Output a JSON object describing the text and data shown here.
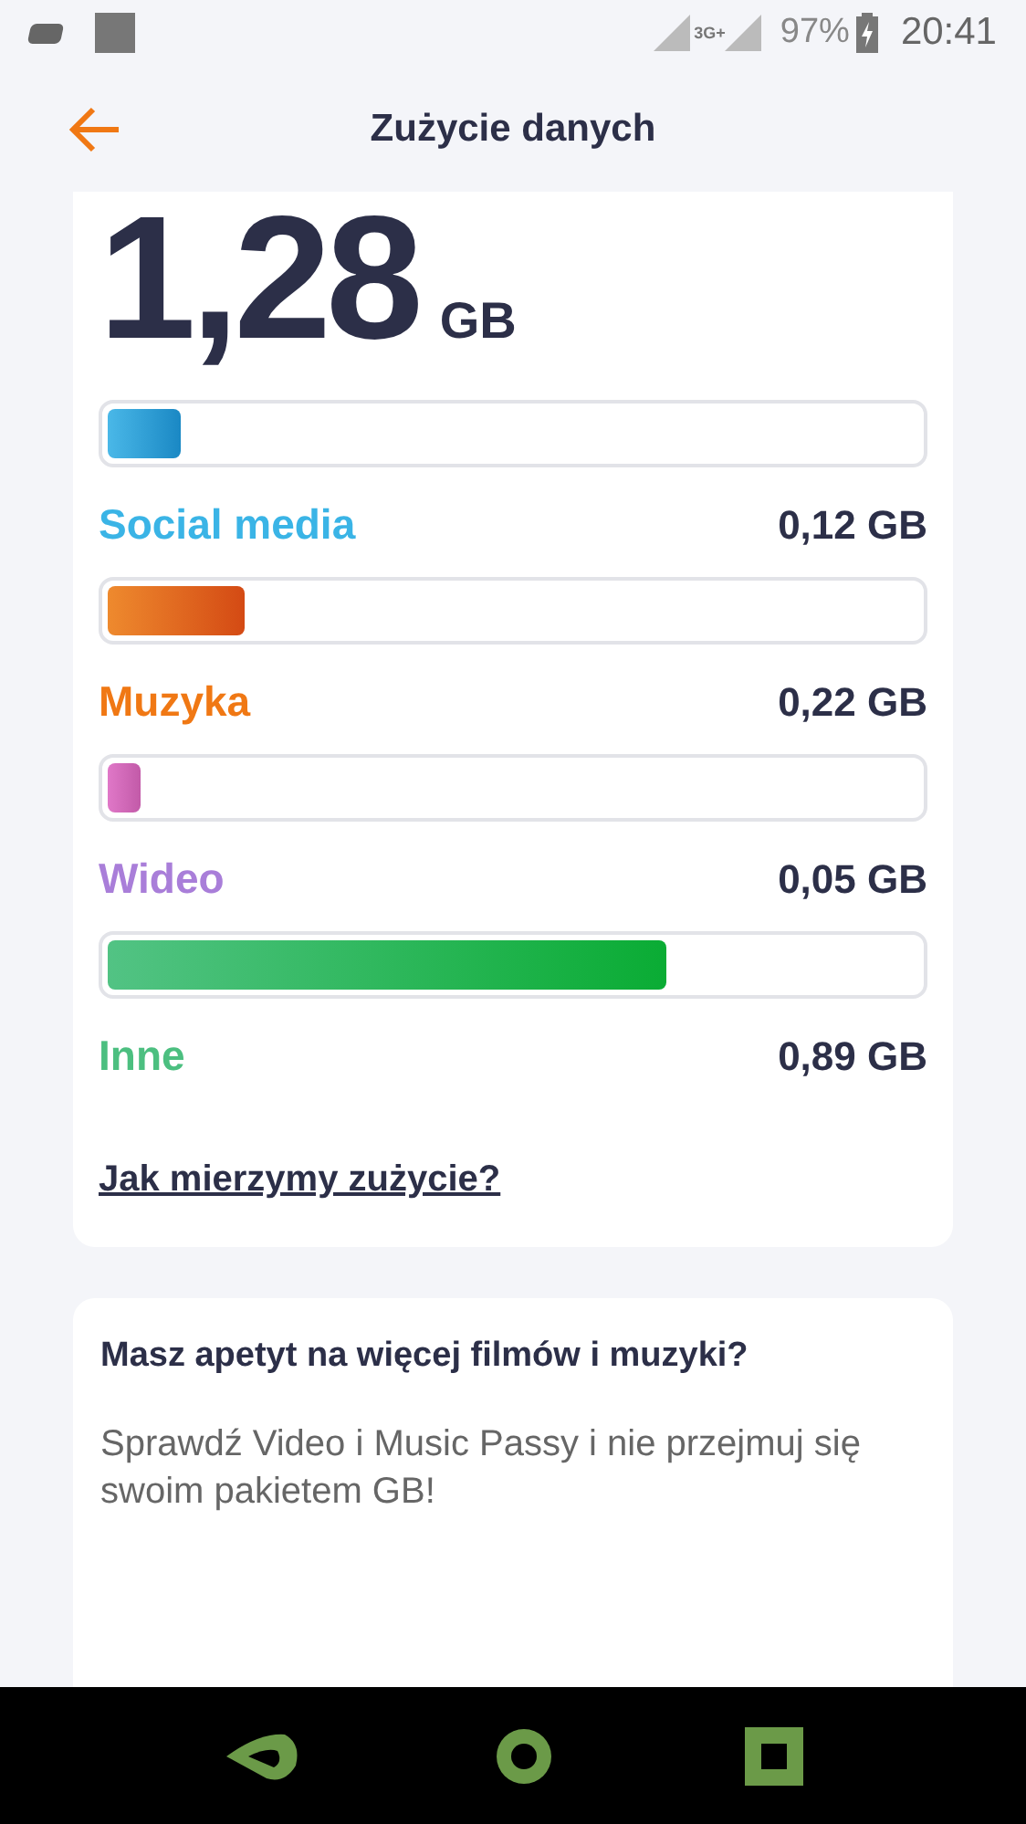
{
  "status_bar": {
    "battery": "97%",
    "time": "20:41",
    "network": "3G+"
  },
  "header": {
    "title": "Zużycie danych"
  },
  "total": {
    "value": "1,28",
    "unit": "GB"
  },
  "categories": [
    {
      "name": "Social media",
      "amount": "0,12 GB",
      "level": 0.09,
      "color": "#3ab4e6"
    },
    {
      "name": "Muzyka",
      "amount": "0,22 GB",
      "level": 0.17,
      "color": "#f07814"
    },
    {
      "name": "Wideo",
      "amount": "0,05 GB",
      "level": 0.04,
      "color": "#a97ed9"
    },
    {
      "name": "Inne",
      "amount": "0,89 GB",
      "level": 0.69,
      "color": "#4cbf80"
    }
  ],
  "link": "Jak mierzymy zużycie?",
  "promo": {
    "title": "Masz apetyt na więcej filmów i muzyki?",
    "text": "Sprawdź Video i Music Passy i nie przejmuj się swoim pakietem GB!"
  }
}
